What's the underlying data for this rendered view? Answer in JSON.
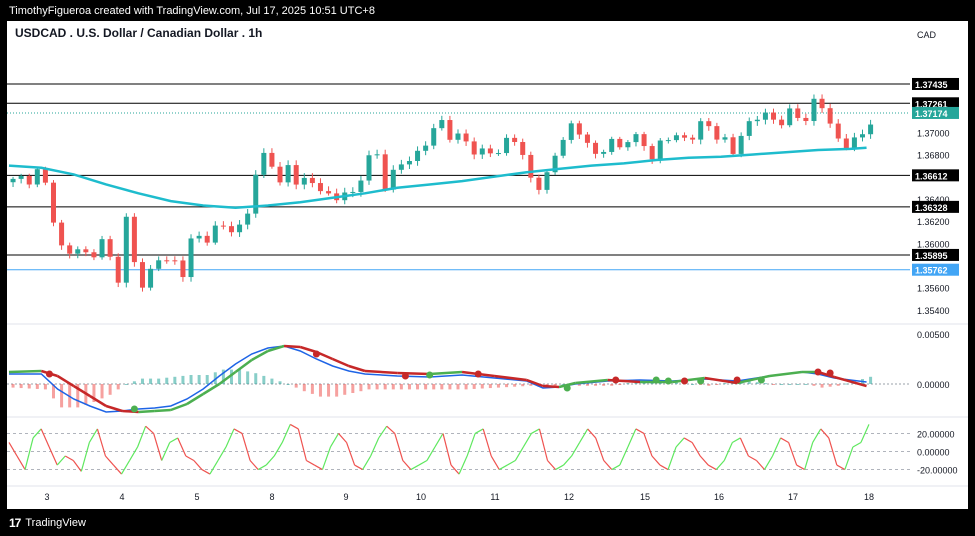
{
  "header": {
    "attribution": "TimothyFigueroa created with TradingView.com, Jul 17, 2025 10:51 UTC+8",
    "symbol_title": "USDCAD . U.S. Dollar / Canadian Dollar . 1h",
    "currency": "CAD"
  },
  "footer": {
    "brand": "TradingView",
    "logo_text": "17"
  },
  "colors": {
    "candle_up": "#26a69a",
    "candle_down": "#ef5350",
    "ma_line": "#1ebccd",
    "macd_line": "#1e64e6",
    "signal_up": "#4caf50",
    "signal_down": "#c62828",
    "dot_up": "#4caf50",
    "dot_down": "#c62828",
    "osc_up": "#5fe85f",
    "osc_down": "#ef5350",
    "level_line": "#000000",
    "current_price": "#26a69a",
    "current_blue": "#42a5f5"
  },
  "chart_data": [
    {
      "type": "candlestick",
      "title": "USDCAD . U.S. Dollar / Canadian Dollar . 1h",
      "x_tick_labels": [
        "3",
        "4",
        "5",
        "8",
        "9",
        "10",
        "11",
        "12",
        "15",
        "16",
        "17",
        "18"
      ],
      "y_tick_labels": [
        "1.37000",
        "1.36800",
        "1.36400",
        "1.36200",
        "1.36000",
        "1.35600",
        "1.35400"
      ],
      "ylim": [
        1.353,
        1.3775
      ],
      "horizontal_levels": [
        1.37435,
        1.37261,
        1.36612,
        1.36328,
        1.35895
      ],
      "current_price": 1.37174,
      "blue_price": 1.35762,
      "close_path": [
        [
          0.0,
          1.3655
        ],
        [
          3.0,
          1.3663
        ],
        [
          4.5,
          1.3645
        ],
        [
          5.3,
          1.3612
        ],
        [
          6.0,
          1.3596
        ],
        [
          7.0,
          1.359
        ],
        [
          8.0,
          1.3595
        ],
        [
          9.5,
          1.3588
        ],
        [
          11.0,
          1.36
        ],
        [
          12.0,
          1.3585
        ],
        [
          13.0,
          1.3572
        ],
        [
          14.0,
          1.362
        ],
        [
          15.0,
          1.358
        ],
        [
          16.0,
          1.3565
        ],
        [
          17.0,
          1.3575
        ],
        [
          18.0,
          1.3585
        ],
        [
          20.0,
          1.3583
        ],
        [
          21.0,
          1.3575
        ],
        [
          22.0,
          1.36
        ],
        [
          25.0,
          1.3612
        ],
        [
          28.0,
          1.3615
        ],
        [
          29.0,
          1.3628
        ],
        [
          30.0,
          1.366
        ],
        [
          31.0,
          1.368
        ],
        [
          32.0,
          1.3675
        ],
        [
          33.0,
          1.365
        ],
        [
          34.0,
          1.3668
        ],
        [
          35.0,
          1.366
        ],
        [
          36.0,
          1.3655
        ],
        [
          38.0,
          1.365
        ],
        [
          39.5,
          1.364
        ],
        [
          42.0,
          1.3645
        ],
        [
          43.5,
          1.3672
        ],
        [
          45.0,
          1.3678
        ],
        [
          46.0,
          1.3655
        ],
        [
          48.0,
          1.367
        ],
        [
          50.0,
          1.3682
        ],
        [
          52.0,
          1.37
        ],
        [
          53.0,
          1.371
        ],
        [
          54.5,
          1.3695
        ],
        [
          56.0,
          1.369
        ],
        [
          58.5,
          1.368
        ],
        [
          60.0,
          1.3682
        ],
        [
          61.5,
          1.37
        ],
        [
          62.5,
          1.369
        ],
        [
          63.5,
          1.366
        ],
        [
          65.0,
          1.3655
        ],
        [
          66.5,
          1.366
        ],
        [
          67.5,
          1.3695
        ],
        [
          69.0,
          1.3705
        ],
        [
          70.5,
          1.3695
        ],
        [
          72.0,
          1.368
        ],
        [
          73.5,
          1.369
        ],
        [
          75.0,
          1.3686
        ],
        [
          76.0,
          1.3698
        ],
        [
          77.5,
          1.369
        ],
        [
          79.0,
          1.368
        ],
        [
          80.0,
          1.369
        ],
        [
          81.5,
          1.3696
        ],
        [
          83.0,
          1.3695
        ],
        [
          84.5,
          1.37
        ],
        [
          85.5,
          1.3708
        ],
        [
          87.0,
          1.37
        ],
        [
          88.0,
          1.369
        ],
        [
          89.0,
          1.368
        ],
        [
          90.0,
          1.37
        ],
        [
          91.5,
          1.3712
        ],
        [
          93.0,
          1.3715
        ],
        [
          94.5,
          1.371
        ],
        [
          96.0,
          1.3715
        ],
        [
          97.5,
          1.3712
        ],
        [
          99.0,
          1.3725
        ],
        [
          100.5,
          1.372
        ],
        [
          101.5,
          1.37
        ],
        [
          102.5,
          1.3686
        ],
        [
          103.5,
          1.369
        ],
        [
          104.5,
          1.3693
        ],
        [
          105.5,
          1.3705
        ],
        [
          106.3,
          1.3717
        ]
      ],
      "ma_path": [
        [
          0,
          1.367
        ],
        [
          4,
          1.3668
        ],
        [
          8,
          1.3662
        ],
        [
          12,
          1.3653
        ],
        [
          16,
          1.3645
        ],
        [
          20,
          1.3638
        ],
        [
          24,
          1.3634
        ],
        [
          28,
          1.3632
        ],
        [
          32,
          1.3634
        ],
        [
          36,
          1.3637
        ],
        [
          40,
          1.3641
        ],
        [
          44,
          1.3645
        ],
        [
          48,
          1.365
        ],
        [
          52,
          1.3653
        ],
        [
          56,
          1.3656
        ],
        [
          60,
          1.366
        ],
        [
          64,
          1.3664
        ],
        [
          68,
          1.3667
        ],
        [
          72,
          1.367
        ],
        [
          76,
          1.3672
        ],
        [
          80,
          1.3675
        ],
        [
          84,
          1.3677
        ],
        [
          88,
          1.3678
        ],
        [
          92,
          1.368
        ],
        [
          96,
          1.3682
        ],
        [
          100,
          1.3684
        ],
        [
          104,
          1.3685
        ],
        [
          106,
          1.3686
        ]
      ],
      "x_domain": [
        0,
        111
      ]
    },
    {
      "type": "line",
      "name": "MACD",
      "y_tick_labels": [
        "0.00500",
        "0.00000"
      ],
      "ylim": [
        -0.0032,
        0.0058
      ],
      "macd_path": [
        [
          0,
          0.001
        ],
        [
          4,
          0.001
        ],
        [
          6,
          -0.0005
        ],
        [
          8,
          -0.0015
        ],
        [
          10,
          -0.0022
        ],
        [
          12,
          -0.0028
        ],
        [
          14,
          -0.0027
        ],
        [
          16,
          -0.0025
        ],
        [
          18,
          -0.0024
        ],
        [
          20,
          -0.0022
        ],
        [
          22,
          -0.0015
        ],
        [
          24,
          -0.0005
        ],
        [
          26,
          0.0008
        ],
        [
          28,
          0.002
        ],
        [
          30,
          0.003
        ],
        [
          32,
          0.0036
        ],
        [
          34,
          0.0038
        ],
        [
          36,
          0.0033
        ],
        [
          38,
          0.0025
        ],
        [
          40,
          0.0018
        ],
        [
          42,
          0.0013
        ],
        [
          44,
          0.001
        ],
        [
          48,
          0.0008
        ],
        [
          52,
          0.0007
        ],
        [
          56,
          0.0009
        ],
        [
          60,
          0.0006
        ],
        [
          64,
          0.0003
        ],
        [
          66,
          -0.0004
        ],
        [
          68,
          -0.0003
        ],
        [
          70,
          0.0
        ],
        [
          74,
          0.0003
        ],
        [
          78,
          0.0004
        ],
        [
          82,
          0.0003
        ],
        [
          86,
          0.0005
        ],
        [
          90,
          0.0003
        ],
        [
          94,
          0.0008
        ],
        [
          98,
          0.0012
        ],
        [
          100,
          0.001
        ],
        [
          102,
          0.0006
        ],
        [
          106,
          0.0002
        ]
      ],
      "signal_path": [
        [
          0,
          0.0012
        ],
        [
          4,
          0.0013
        ],
        [
          6,
          0.0008
        ],
        [
          8,
          -0.0002
        ],
        [
          10,
          -0.0012
        ],
        [
          12,
          -0.0022
        ],
        [
          14,
          -0.0027
        ],
        [
          16,
          -0.0028
        ],
        [
          18,
          -0.0027
        ],
        [
          20,
          -0.0026
        ],
        [
          22,
          -0.002
        ],
        [
          24,
          -0.001
        ],
        [
          26,
          0.0
        ],
        [
          28,
          0.0012
        ],
        [
          30,
          0.0024
        ],
        [
          32,
          0.0033
        ],
        [
          34,
          0.0038
        ],
        [
          36,
          0.0037
        ],
        [
          38,
          0.0032
        ],
        [
          40,
          0.0025
        ],
        [
          42,
          0.0018
        ],
        [
          44,
          0.0013
        ],
        [
          48,
          0.0011
        ],
        [
          52,
          0.001
        ],
        [
          56,
          0.0012
        ],
        [
          60,
          0.0008
        ],
        [
          64,
          0.0004
        ],
        [
          66,
          -0.0002
        ],
        [
          68,
          -0.0003
        ],
        [
          70,
          0.0001
        ],
        [
          74,
          0.0004
        ],
        [
          78,
          0.0002
        ],
        [
          82,
          0.0002
        ],
        [
          86,
          0.0006
        ],
        [
          90,
          0.0001
        ],
        [
          94,
          0.0008
        ],
        [
          98,
          0.0012
        ],
        [
          100,
          0.0012
        ],
        [
          102,
          0.0007
        ],
        [
          106,
          -0.0002
        ]
      ],
      "cross_dots": [
        {
          "x": 5,
          "y": 0.001,
          "dir": "down"
        },
        {
          "x": 15.5,
          "y": -0.0025,
          "dir": "up"
        },
        {
          "x": 38,
          "y": 0.003,
          "dir": "down"
        },
        {
          "x": 49,
          "y": 0.0008,
          "dir": "down"
        },
        {
          "x": 52,
          "y": 0.0009,
          "dir": "up"
        },
        {
          "x": 58,
          "y": 0.001,
          "dir": "down"
        },
        {
          "x": 69,
          "y": -0.0004,
          "dir": "up"
        },
        {
          "x": 75,
          "y": 0.0004,
          "dir": "down"
        },
        {
          "x": 80,
          "y": 0.0004,
          "dir": "up"
        },
        {
          "x": 81.5,
          "y": 0.0003,
          "dir": "up"
        },
        {
          "x": 83.5,
          "y": 0.0003,
          "dir": "down"
        },
        {
          "x": 85.5,
          "y": 0.0003,
          "dir": "up"
        },
        {
          "x": 90,
          "y": 0.0004,
          "dir": "down"
        },
        {
          "x": 93,
          "y": 0.0004,
          "dir": "up"
        },
        {
          "x": 100,
          "y": 0.0012,
          "dir": "down"
        },
        {
          "x": 101.5,
          "y": 0.0011,
          "dir": "down"
        }
      ]
    },
    {
      "type": "line",
      "name": "Oscillator",
      "y_tick_labels": [
        "20.00000",
        "0.00000",
        "-20.00000"
      ],
      "ylim": [
        -36,
        36
      ],
      "values": [
        10,
        -5,
        -20,
        15,
        25,
        5,
        -15,
        -5,
        -10,
        -22,
        10,
        25,
        -5,
        -15,
        -25,
        -10,
        5,
        28,
        20,
        -10,
        10,
        15,
        -5,
        -10,
        -20,
        -25,
        -10,
        5,
        25,
        20,
        -10,
        -20,
        -15,
        -5,
        10,
        30,
        25,
        -10,
        -15,
        -20,
        5,
        20,
        10,
        -15,
        -20,
        -5,
        15,
        28,
        20,
        -10,
        -20,
        -15,
        -10,
        5,
        20,
        -15,
        -25,
        -5,
        20,
        25,
        -5,
        -20,
        -15,
        -10,
        5,
        20,
        25,
        -10,
        -20,
        -15,
        -5,
        10,
        25,
        15,
        -10,
        -20,
        -15,
        5,
        25,
        20,
        -5,
        -15,
        -20,
        5,
        15,
        10,
        -5,
        -15,
        -20,
        -10,
        10,
        15,
        -5,
        -10,
        -20,
        -5,
        15,
        10,
        -15,
        -20,
        10,
        25,
        15,
        -15,
        -20,
        5,
        10,
        30
      ]
    }
  ]
}
